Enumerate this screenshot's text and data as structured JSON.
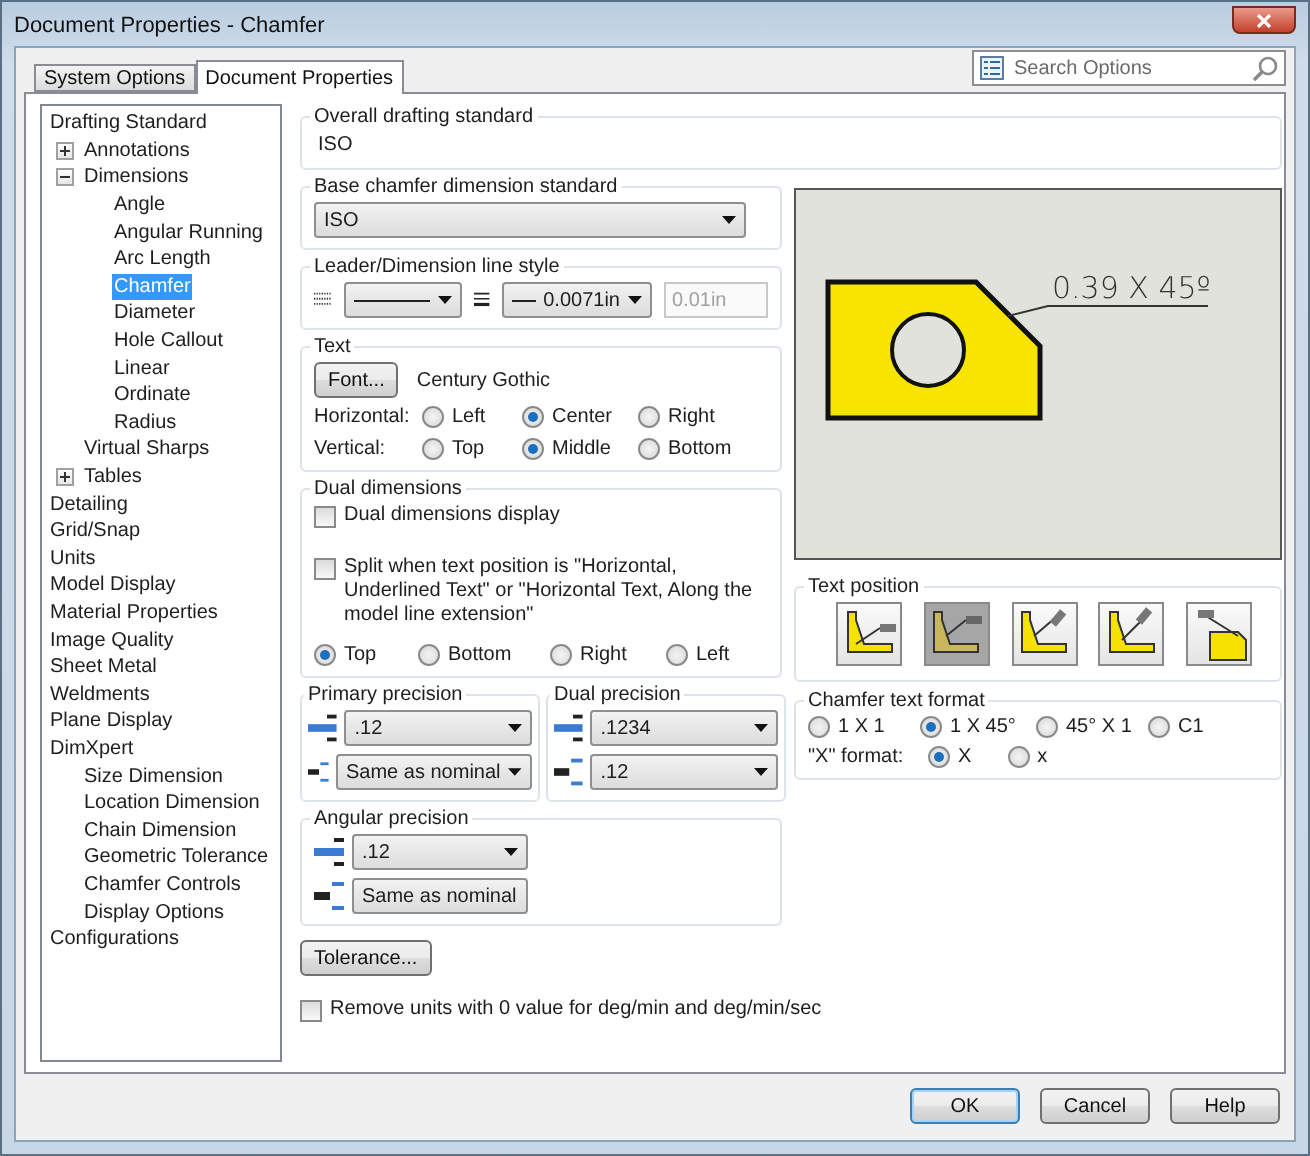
{
  "window": {
    "title": "Document Properties - Chamfer"
  },
  "tabs": [
    {
      "label": "System Options",
      "selected": false
    },
    {
      "label": "Document Properties",
      "selected": true
    }
  ],
  "search": {
    "placeholder": "Search Options"
  },
  "tree": [
    {
      "label": "Drafting Standard",
      "selected": false,
      "children": [
        {
          "label": "Annotations",
          "selected": false,
          "expanded": false
        },
        {
          "label": "Dimensions",
          "selected": false,
          "expanded": true,
          "children": [
            {
              "label": "Angle",
              "selected": false
            },
            {
              "label": "Angular Running",
              "selected": false
            },
            {
              "label": "Arc Length",
              "selected": false
            },
            {
              "label": "Chamfer",
              "selected": true
            },
            {
              "label": "Diameter",
              "selected": false
            },
            {
              "label": "Hole Callout",
              "selected": false
            },
            {
              "label": "Linear",
              "selected": false
            },
            {
              "label": "Ordinate",
              "selected": false
            },
            {
              "label": "Radius",
              "selected": false
            }
          ]
        },
        {
          "label": "Virtual Sharps",
          "selected": false
        },
        {
          "label": "Tables",
          "selected": false,
          "expanded": false
        }
      ]
    },
    {
      "label": "Detailing",
      "selected": false
    },
    {
      "label": "Grid/Snap",
      "selected": false
    },
    {
      "label": "Units",
      "selected": false
    },
    {
      "label": "Model Display",
      "selected": false
    },
    {
      "label": "Material Properties",
      "selected": false
    },
    {
      "label": "Image Quality",
      "selected": false
    },
    {
      "label": "Sheet Metal",
      "selected": false
    },
    {
      "label": "Weldments",
      "selected": false
    },
    {
      "label": "Plane Display",
      "selected": false
    },
    {
      "label": "DimXpert",
      "selected": false,
      "children": [
        {
          "label": "Size Dimension",
          "selected": false
        },
        {
          "label": "Location Dimension",
          "selected": false
        },
        {
          "label": "Chain Dimension",
          "selected": false
        },
        {
          "label": "Geometric Tolerance",
          "selected": false
        },
        {
          "label": "Chamfer Controls",
          "selected": false
        },
        {
          "label": "Display Options",
          "selected": false
        }
      ]
    },
    {
      "label": "Configurations",
      "selected": false
    }
  ],
  "overall_standard": {
    "label": "Overall drafting standard",
    "value": "ISO"
  },
  "base_chamfer_standard": {
    "label": "Base chamfer dimension standard",
    "value": "ISO"
  },
  "leader_line_style": {
    "label": "Leader/Dimension line style",
    "thickness": "0.0071in",
    "custom_thickness": "0.01in",
    "custom_disabled": true
  },
  "text": {
    "label": "Text",
    "font_button": "Font...",
    "font_name": "Century Gothic",
    "horizontal": {
      "label": "Horizontal:",
      "options": [
        {
          "label": "Left",
          "selected": false
        },
        {
          "label": "Center",
          "selected": true
        },
        {
          "label": "Right",
          "selected": false
        }
      ]
    },
    "vertical": {
      "label": "Vertical:",
      "options": [
        {
          "label": "Top",
          "selected": false
        },
        {
          "label": "Middle",
          "selected": true
        },
        {
          "label": "Bottom",
          "selected": false
        }
      ]
    }
  },
  "dual_dimensions": {
    "label": "Dual dimensions",
    "display": {
      "label": "Dual dimensions display",
      "checked": false
    },
    "split": {
      "label": "Split when text position is \"Horizontal, Underlined Text\" or \"Horizontal Text, Along the model line extension\"",
      "checked": false
    },
    "positions": [
      {
        "label": "Top",
        "selected": true
      },
      {
        "label": "Bottom",
        "selected": false
      },
      {
        "label": "Right",
        "selected": false
      },
      {
        "label": "Left",
        "selected": false
      }
    ]
  },
  "precision": [
    {
      "label": "Primary precision",
      "value": ".12",
      "tolerance": "Same as nominal"
    },
    {
      "label": "Dual precision",
      "value": ".1234",
      "tolerance": ".12"
    }
  ],
  "angular_precision": {
    "label": "Angular precision",
    "value": ".12",
    "tolerance": "Same as nominal"
  },
  "tolerance_button": "Tolerance...",
  "remove_units": {
    "label": "Remove units with 0 value for deg/min and deg/min/sec",
    "checked": false
  },
  "preview": {
    "dimension_text": "0.39 X 45º"
  },
  "text_position": {
    "label": "Text position",
    "options": [
      {
        "selected": false
      },
      {
        "selected": true
      },
      {
        "selected": false
      },
      {
        "selected": false
      },
      {
        "selected": false
      }
    ]
  },
  "chamfer_text_format": {
    "label": "Chamfer text format",
    "options": [
      {
        "label": "1 X 1",
        "selected": false
      },
      {
        "label": "1 X 45°",
        "selected": true
      },
      {
        "label": "45° X 1",
        "selected": false
      },
      {
        "label": "C1",
        "selected": false
      }
    ],
    "x_format": {
      "label": "\"X\" format:",
      "options": [
        {
          "label": "X",
          "selected": true
        },
        {
          "label": "x",
          "selected": false
        }
      ]
    }
  },
  "buttons": [
    {
      "label": "OK",
      "default": true
    },
    {
      "label": "Cancel",
      "default": false
    },
    {
      "label": "Help",
      "default": false
    }
  ]
}
